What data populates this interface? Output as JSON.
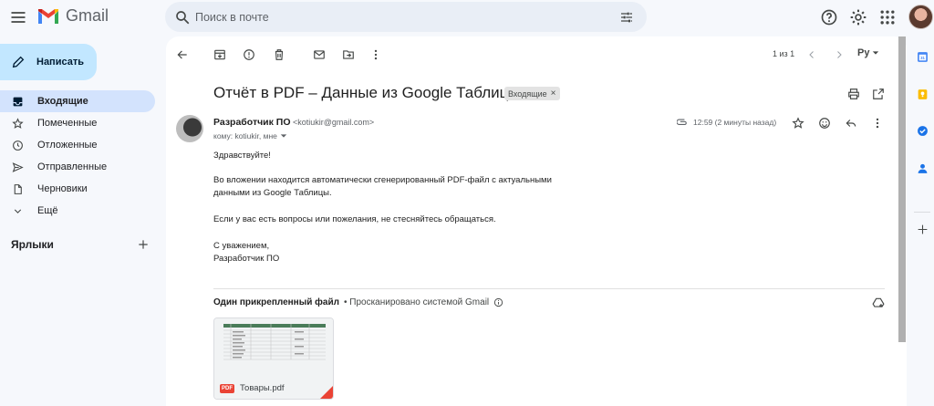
{
  "app": {
    "name": "Gmail"
  },
  "search": {
    "placeholder": "Поиск в почте"
  },
  "compose": {
    "label": "Написать"
  },
  "nav": {
    "items": [
      {
        "label": "Входящие",
        "icon": "inbox-icon",
        "active": true
      },
      {
        "label": "Помеченные",
        "icon": "star-icon"
      },
      {
        "label": "Отложенные",
        "icon": "clock-icon"
      },
      {
        "label": "Отправленные",
        "icon": "send-icon"
      },
      {
        "label": "Черновики",
        "icon": "draft-icon"
      },
      {
        "label": "Ещё",
        "icon": "chevron-down-icon"
      }
    ]
  },
  "labels": {
    "title": "Ярлыки"
  },
  "toolbar": {
    "pager": "1 из 1",
    "lang": "Py"
  },
  "email": {
    "subject": "Отчёт в PDF – Данные из Google Таблицы",
    "label_badge": "Входящие",
    "sender_name": "Разработчик ПО",
    "sender_email": "<kotiukir@gmail.com>",
    "recipients": "кому: kotiukir, мне",
    "time": "12:59 (2 минуты назад)",
    "body": {
      "greeting": "Здравствуйте!",
      "para1_line1": "Во вложении находится автоматически сгенерированный PDF-файл с актуальными",
      "para1_line2": "данными из Google Таблицы.",
      "para2": "Если у вас есть вопросы или пожелания, не стесняйтесь обращаться.",
      "signoff": "С уважением,",
      "signature": "Разработчик ПО"
    },
    "attachments": {
      "title": "Один прикрепленный файл",
      "scan_note": "• Просканировано системой Gmail",
      "files": [
        {
          "name": "Товары.pdf",
          "type": "PDF"
        }
      ]
    }
  },
  "colors": {
    "background": "#f6f8fc",
    "compose_bg": "#c2e7ff",
    "active_nav": "#d3e3fd",
    "pdf_red": "#ea4335"
  }
}
